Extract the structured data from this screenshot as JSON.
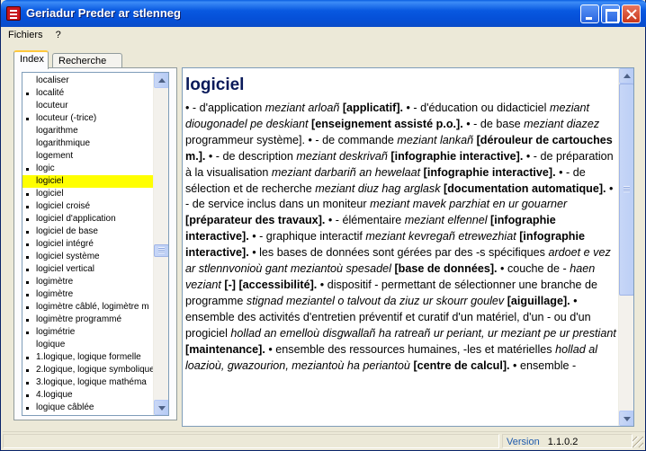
{
  "window": {
    "title": "Geriadur Preder ar stlenneg"
  },
  "menu": [
    {
      "label": "Fichiers"
    },
    {
      "label": "?"
    }
  ],
  "tabs": [
    {
      "label": "Index"
    },
    {
      "label": "Recherche"
    }
  ],
  "index_list": {
    "items": [
      {
        "text": "localiser",
        "bullet": false
      },
      {
        "text": "localité",
        "bullet": true
      },
      {
        "text": "locuteur",
        "bullet": false
      },
      {
        "text": "locuteur (-trice)",
        "bullet": true
      },
      {
        "text": "logarithme",
        "bullet": false
      },
      {
        "text": "logarithmique",
        "bullet": false
      },
      {
        "text": "logement",
        "bullet": false
      },
      {
        "text": "logic",
        "bullet": true
      },
      {
        "text": "logiciel",
        "bullet": false,
        "selected": true
      },
      {
        "text": "logiciel",
        "bullet": true
      },
      {
        "text": "logiciel croisé",
        "bullet": true
      },
      {
        "text": "logiciel d'application",
        "bullet": true
      },
      {
        "text": "logiciel de base",
        "bullet": true
      },
      {
        "text": "logiciel intégré",
        "bullet": true
      },
      {
        "text": "logiciel système",
        "bullet": true
      },
      {
        "text": "logiciel vertical",
        "bullet": true
      },
      {
        "text": "logimètre",
        "bullet": true
      },
      {
        "text": "logimètre",
        "bullet": true
      },
      {
        "text": "logimètre câblé, logimètre m",
        "bullet": true
      },
      {
        "text": "logimètre programmé",
        "bullet": true
      },
      {
        "text": "logimétrie",
        "bullet": true
      },
      {
        "text": "logique",
        "bullet": false
      },
      {
        "text": "1.logique, logique formelle",
        "bullet": true
      },
      {
        "text": "2.logique, logique symbolique",
        "bullet": true
      },
      {
        "text": "3.logique, logique mathéma",
        "bullet": true
      },
      {
        "text": "4.logique",
        "bullet": true
      },
      {
        "text": "logique câblée",
        "bullet": true
      }
    ]
  },
  "entry": {
    "headword": "logiciel",
    "segments": [
      {
        "t": "• - d'application ",
        "s": "n"
      },
      {
        "t": "meziant arloañ",
        "s": "i"
      },
      {
        "t": " [applicatif].",
        "s": "b"
      },
      {
        "t": " • - d'éducation ou didacticiel ",
        "s": "n"
      },
      {
        "t": "meziant diougonadel pe deskiant",
        "s": "i"
      },
      {
        "t": " [enseignement assisté p.o.].",
        "s": "b"
      },
      {
        "t": " • - de base ",
        "s": "n"
      },
      {
        "t": "meziant diazez",
        "s": "i"
      },
      {
        "t": " programmeur système].",
        "s": "n"
      },
      {
        "t": " • - de commande ",
        "s": "n"
      },
      {
        "t": "meziant lankañ",
        "s": "i"
      },
      {
        "t": " [dérouleur de cartouches m.].",
        "s": "b"
      },
      {
        "t": " • - de description ",
        "s": "n"
      },
      {
        "t": "meziant deskrivañ",
        "s": "i"
      },
      {
        "t": " [infographie interactive].",
        "s": "b"
      },
      {
        "t": " • - de préparation à la visualisation ",
        "s": "n"
      },
      {
        "t": "meziant darbariñ an hewelaat",
        "s": "i"
      },
      {
        "t": " [infographie interactive].",
        "s": "b"
      },
      {
        "t": " • - de sélection et de recherche ",
        "s": "n"
      },
      {
        "t": "meziant diuz hag arglask",
        "s": "i"
      },
      {
        "t": " [documentation automatique].",
        "s": "b"
      },
      {
        "t": " • - de service inclus dans un moniteur ",
        "s": "n"
      },
      {
        "t": "meziant mavek parzhiat en ur gouarner",
        "s": "i"
      },
      {
        "t": " [préparateur des travaux].",
        "s": "b"
      },
      {
        "t": " • - élémentaire ",
        "s": "n"
      },
      {
        "t": "meziant elfennel",
        "s": "i"
      },
      {
        "t": " [infographie interactive].",
        "s": "b"
      },
      {
        "t": " • - graphique interactif ",
        "s": "n"
      },
      {
        "t": "meziant kevregañ etrewezhiat",
        "s": "i"
      },
      {
        "t": " [infographie interactive].",
        "s": "b"
      },
      {
        "t": " • les bases de données sont gérées par des -s spécifiques ",
        "s": "n"
      },
      {
        "t": "ardoet e vez ar stlennvonioù gant meziantoù spesadel",
        "s": "i"
      },
      {
        "t": " [base de données].",
        "s": "b"
      },
      {
        "t": " • couche de - ",
        "s": "n"
      },
      {
        "t": "haen veziant",
        "s": "i"
      },
      {
        "t": " [-] [accessibilité].",
        "s": "b"
      },
      {
        "t": " • dispositif - permettant de sélectionner une branche de programme ",
        "s": "n"
      },
      {
        "t": "stignad meziantel o talvout da ziuz ur skourr goulev",
        "s": "i"
      },
      {
        "t": " [aiguillage].",
        "s": "b"
      },
      {
        "t": " • ensemble des activités d'entretien préventif et curatif d'un matériel, d'un - ou d'un progiciel ",
        "s": "n"
      },
      {
        "t": "hollad an emelloù disgwallañ ha ratreañ ur periant, ur meziant pe ur prestiant",
        "s": "i"
      },
      {
        "t": " [maintenance].",
        "s": "b"
      },
      {
        "t": " • ensemble des ressources humaines, -les et matérielles ",
        "s": "n"
      },
      {
        "t": "hollad al loazioù, gwazourion, meziantoù ha periantoù",
        "s": "i"
      },
      {
        "t": " [centre de calcul].",
        "s": "b"
      },
      {
        "t": " • ensemble -",
        "s": "n"
      }
    ]
  },
  "status": {
    "version_label": "Version",
    "version_number": "1.1.0.2"
  }
}
